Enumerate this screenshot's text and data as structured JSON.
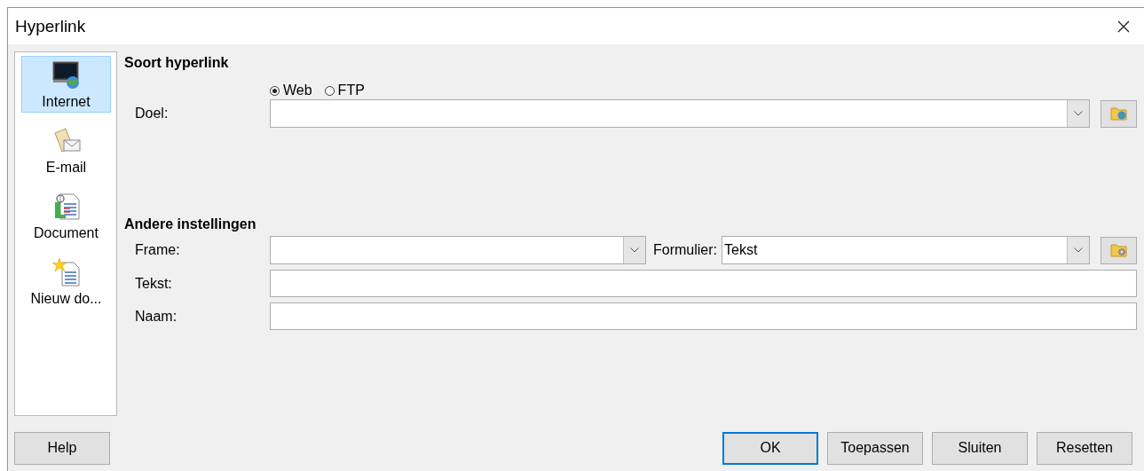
{
  "window": {
    "title": "Hyperlink"
  },
  "sidebar": {
    "items": [
      {
        "label": "Internet",
        "kind": "internet",
        "selected": true
      },
      {
        "label": "E-mail",
        "kind": "mail",
        "selected": false
      },
      {
        "label": "Document",
        "kind": "document",
        "selected": false
      },
      {
        "label": "Nieuw do...",
        "kind": "new",
        "selected": false
      }
    ]
  },
  "hyperlink_type": {
    "heading": "Soort hyperlink",
    "options": [
      {
        "label": "Web",
        "selected": true
      },
      {
        "label": "FTP",
        "selected": false
      }
    ],
    "target": {
      "label": "Doel:"
    }
  },
  "other_settings": {
    "heading": "Andere instellingen",
    "frame": {
      "label": "Frame:"
    },
    "form": {
      "label": "Formulier:",
      "value": "Tekst"
    },
    "text": {
      "label": "Tekst:"
    },
    "name": {
      "label": "Naam:"
    }
  },
  "help_button": {
    "label": "Help"
  },
  "buttons": [
    {
      "label": "OK",
      "default": true
    },
    {
      "label": "Toepassen",
      "default": false
    },
    {
      "label": "Sluiten",
      "default": false
    },
    {
      "label": "Resetten",
      "default": false
    }
  ]
}
